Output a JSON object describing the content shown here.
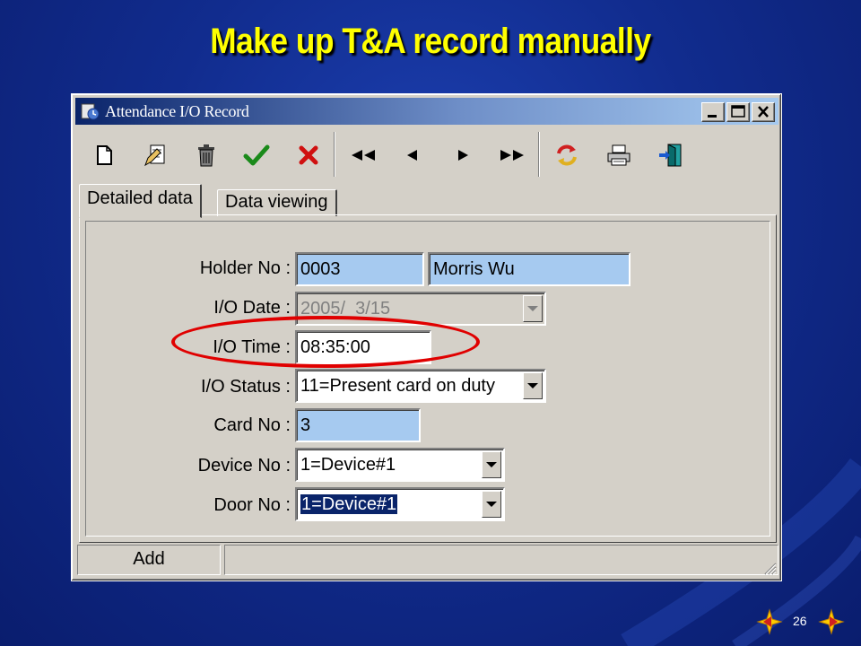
{
  "slide": {
    "title": "Make up T&A record manually",
    "page_number": "26"
  },
  "window": {
    "title": "Attendance I/O Record",
    "tabs": [
      {
        "label": "Detailed data",
        "active": true
      },
      {
        "label": "Data viewing",
        "active": false
      }
    ],
    "toolbar": [
      {
        "icon": "new-document-icon"
      },
      {
        "icon": "edit-document-icon"
      },
      {
        "icon": "trash-icon"
      },
      {
        "icon": "checkmark-icon"
      },
      {
        "icon": "cancel-x-icon"
      },
      {
        "icon": "first-record-icon"
      },
      {
        "icon": "previous-record-icon"
      },
      {
        "icon": "next-record-icon"
      },
      {
        "icon": "last-record-icon"
      },
      {
        "icon": "refresh-icon"
      },
      {
        "icon": "printer-icon"
      },
      {
        "icon": "exit-icon"
      }
    ]
  },
  "form": {
    "holder_no": {
      "label": "Holder No :",
      "value": "0003",
      "name_value": "Morris Wu"
    },
    "io_date": {
      "label": "I/O Date :",
      "value": "2005/  3/15"
    },
    "io_time": {
      "label": "I/O Time :",
      "value": "08:35:00"
    },
    "io_status": {
      "label": "I/O Status :",
      "value": "11=Present card on duty"
    },
    "card_no": {
      "label": "Card No :",
      "value": "3"
    },
    "device_no": {
      "label": "Device No :",
      "value": "1=Device#1"
    },
    "door_no": {
      "label": "Door No :",
      "value": "1=Device#1"
    }
  },
  "statusbar": {
    "mode": "Add"
  },
  "colors": {
    "title_yellow": "#ffff00",
    "highlight_red": "#e00000",
    "field_blue": "#a6caf0"
  }
}
